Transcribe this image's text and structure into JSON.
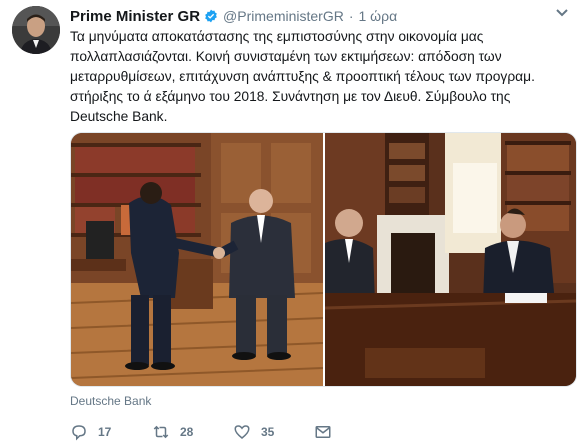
{
  "tweet": {
    "author_name": "Prime Minister GR",
    "handle": "@PrimeministerGR",
    "separator": "·",
    "time": "1 ώρα",
    "lines": [
      "Τα μηνύματα αποκατάστασης της εμπιστοσύνης στην οικονομία μας",
      "πολλαπλασιάζονται. Κοινή συνισταμένη των εκτιμήσεων: απόδοση των",
      "μεταρρυθμίσεων, επιτάχυνση ανάπτυξης & προοπτική τέλους των προγραμ.",
      "στήριξης το ά εξάμηνο του 2018. Συνάντηση με τον Διευθ. Σύμβουλο της",
      "Deutsche Bank."
    ],
    "media_tag": "Deutsche Bank",
    "actions": {
      "replies": "17",
      "retweets": "28",
      "likes": "35"
    },
    "colors": {
      "text": "#14171a",
      "secondary": "#657786",
      "verified": "#1da1f2"
    },
    "icons": [
      "verified-badge-icon",
      "chevron-down-icon",
      "reply-icon",
      "retweet-icon",
      "like-icon",
      "message-icon"
    ]
  }
}
